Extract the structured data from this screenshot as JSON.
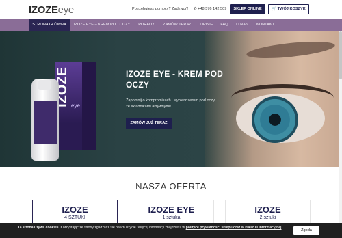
{
  "header": {
    "logo_bold": "IZOZE",
    "logo_light": "eye",
    "help_text": "Potrzebujesz pomocy? Zadzwoń!",
    "phone_icon": "phone-icon",
    "phone": "+48 576 142 509",
    "shop_button": "SKLEP ONLINE",
    "cart_icon": "basket-icon",
    "cart_button": "TWÓJ KOSZYK"
  },
  "nav": {
    "items": [
      "STRONA GŁÓWNA",
      "IZOZE EYE – KREM POD OCZY",
      "PORADY",
      "ZAMÓW TERAZ",
      "OPINIE",
      "FAQ",
      "O NAS",
      "KONTAKT"
    ],
    "active_index": 0
  },
  "hero": {
    "product_brand": "IZOZE",
    "product_sub": "eye",
    "title": "IZOZE EYE - KREM POD OCZY",
    "subtitle": "Zapomnij o kompromisach i wybierz serum pod oczy ze składnikami aktywnymi!",
    "button": "ZAMÓW JUŻ TERAZ"
  },
  "offer": {
    "title": "NASZA OFERTA",
    "cards": [
      {
        "name": "IZOZE",
        "qty": "4 SZTUKI"
      },
      {
        "name": "IZOZE EYE",
        "qty": "1 sztuka"
      },
      {
        "name": "IZOZE",
        "qty": "2 sztuki"
      }
    ]
  },
  "cookie": {
    "text_a": "Ta strona używa cookies.",
    "text_b": " Korzystając ze strony zgadzasz się na ich użycie. Więcej informacji znajdziesz w ",
    "link": "polityce prywatności sklepu oraz w klauzuli informacyjnej",
    "text_c": ".",
    "button": "Zgoda"
  },
  "colors": {
    "navy": "#1e1f4e",
    "nav_purple": "#8a6d97",
    "hero_bg": "#2c4446",
    "cookie_bg": "#202020"
  }
}
